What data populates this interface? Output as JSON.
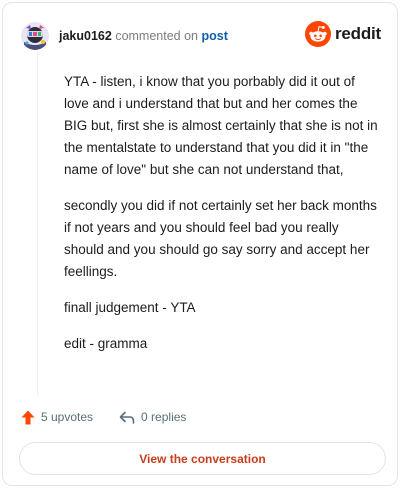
{
  "comment": {
    "username": "jaku0162",
    "action_text": "commented on",
    "post_link": "post",
    "paragraphs": [
      "YTA - listen, i know that you porbably did it out of love and i understand that but and her comes the BIG but, first she is almost certainly that she is not in the mentalstate to understand that you did it in \"the name of love\" but she can not understand that,",
      "secondly you did if not certainly set her back months if not years and you should feel bad you really should and you should go say sorry and accept her feellings.",
      "finall judgement - YTA",
      "edit - gramma"
    ]
  },
  "brand": {
    "wordmark": "reddit",
    "icon": "reddit-snoo-icon",
    "color": "#ff4500"
  },
  "actions": {
    "upvotes": "5 upvotes",
    "replies": "0 replies",
    "upvote_icon": "upvote-arrow-icon",
    "reply_icon": "reply-arrow-icon",
    "upvote_color": "#ff4500"
  },
  "cta": {
    "label": "View the conversation",
    "color": "#c83d1b"
  }
}
